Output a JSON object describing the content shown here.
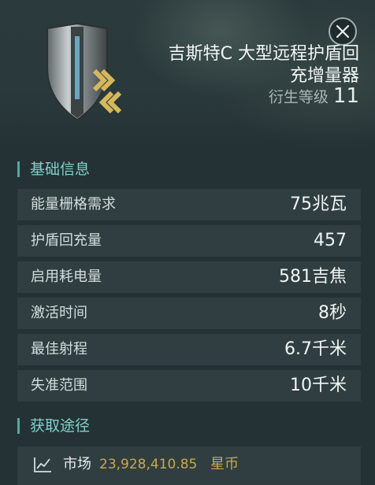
{
  "item": {
    "title": "吉斯特C 大型远程护盾回\n充增量器",
    "meta_level_label": "衍生等级",
    "meta_level_value": "11"
  },
  "sections": {
    "basic_info": "基础信息",
    "acquire": "获取途径"
  },
  "stats": [
    {
      "label": "能量栅格需求",
      "value": "75兆瓦"
    },
    {
      "label": "护盾回充量",
      "value": "457"
    },
    {
      "label": "启用耗电量",
      "value": "581吉焦"
    },
    {
      "label": "激活时间",
      "value": "8秒"
    },
    {
      "label": "最佳射程",
      "value": "6.7千米"
    },
    {
      "label": "失准范围",
      "value": "10千米"
    }
  ],
  "market": {
    "label": "市场",
    "price": "23,928,410.85",
    "unit": "星币"
  },
  "icons": {
    "close": "close-icon",
    "item": "shield-module-icon",
    "market": "market-trend-icon"
  },
  "colors": {
    "accent": "#7fd0c8",
    "price": "#c9a94a",
    "background": "#243236"
  }
}
